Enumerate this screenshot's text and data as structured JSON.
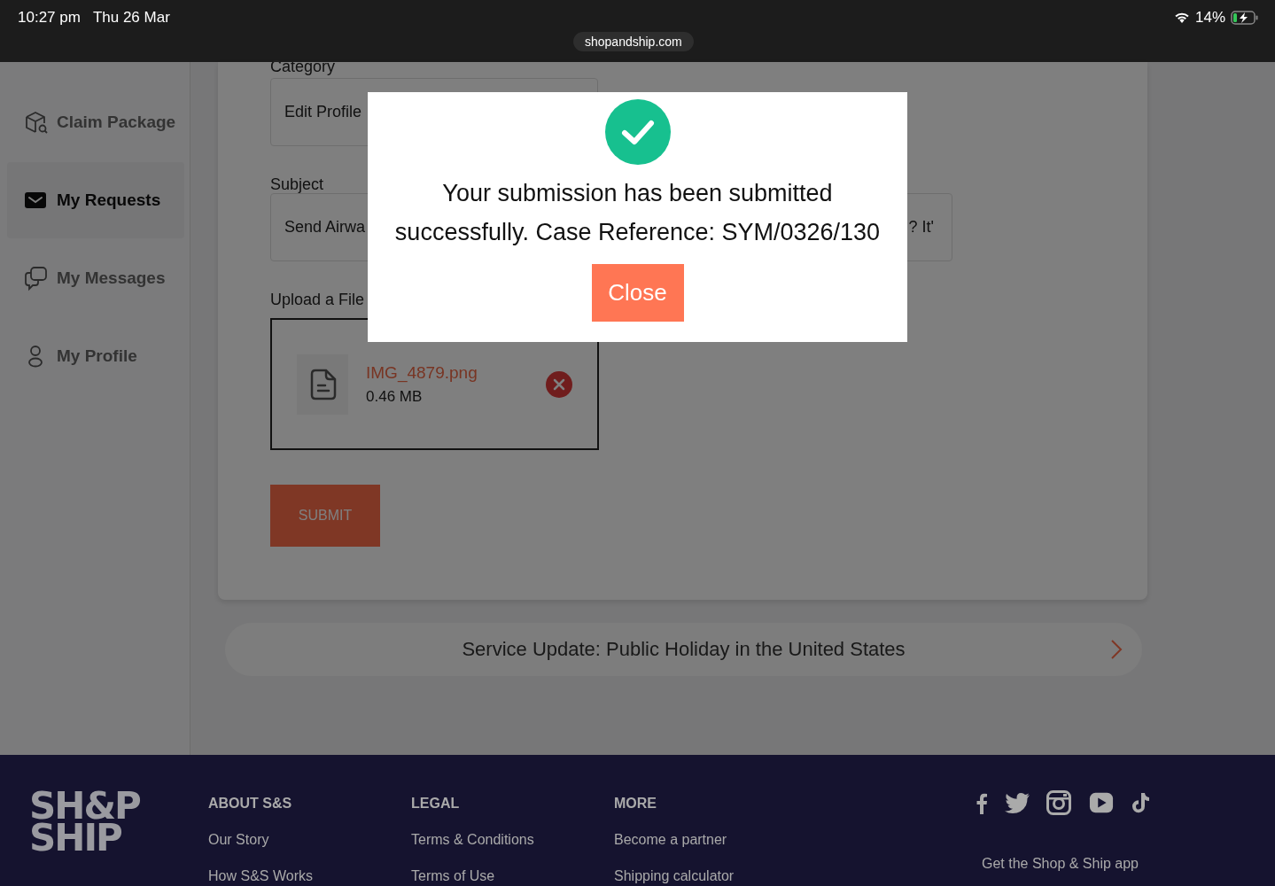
{
  "status_bar": {
    "time": "10:27 pm",
    "date": "Thu 26 Mar",
    "url": "shopandship.com",
    "battery": "14%"
  },
  "sidebar": {
    "items": [
      {
        "label": "Claim Package",
        "kind": "box",
        "selected": false
      },
      {
        "label": "My Requests",
        "kind": "mail",
        "selected": true
      },
      {
        "label": "My Messages",
        "kind": "chat",
        "selected": false
      },
      {
        "label": "My Profile",
        "kind": "person",
        "selected": false
      }
    ]
  },
  "form": {
    "category": {
      "label": "Category",
      "value": "Edit Profile"
    },
    "subject": {
      "label": "Subject",
      "value": "Send Airwa",
      "value_end": "? It'"
    },
    "upload": {
      "label": "Upload a File",
      "file_name": "IMG_4879.png",
      "file_size": "0.46 MB"
    },
    "submit": "SUBMIT"
  },
  "notice": "Service Update: Public Holiday in the United States",
  "modal": {
    "message": "Your submission has been submitted successfully. Case Reference: SYM/0326/130",
    "button": "Close"
  },
  "footer": {
    "logo": [
      "SH&P",
      "SHIP"
    ],
    "columns": [
      {
        "heading": "ABOUT S&S",
        "links": [
          "Our Story",
          "How S&S Works"
        ]
      },
      {
        "heading": "LEGAL",
        "links": [
          "Terms & Conditions",
          "Terms of Use"
        ]
      },
      {
        "heading": "MORE",
        "links": [
          "Become a partner",
          "Shipping calculator"
        ]
      }
    ],
    "social": [
      {
        "kind": "f"
      },
      {
        "kind": "bird"
      },
      {
        "kind": "camera"
      },
      {
        "kind": "play"
      },
      {
        "kind": "note"
      }
    ],
    "app_text": "Get the Shop & Ship app"
  }
}
